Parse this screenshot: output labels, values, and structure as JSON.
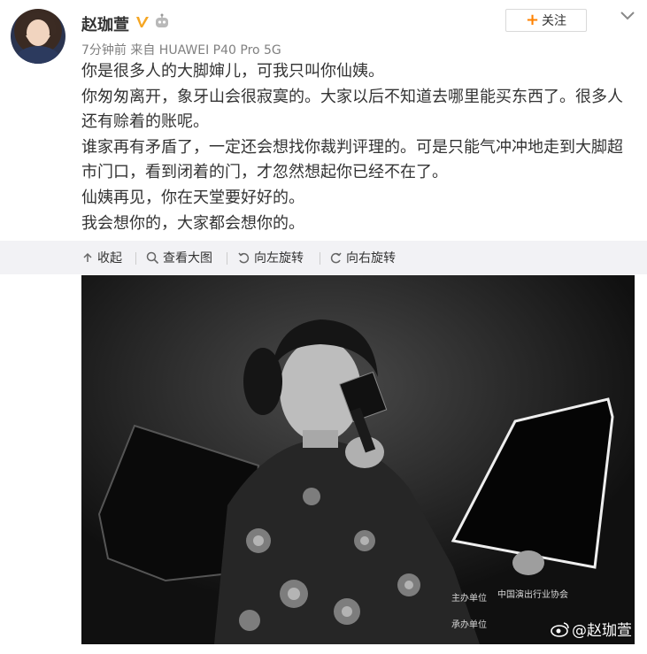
{
  "user": {
    "name": "赵珈萱",
    "verified_icon": "verified-v-icon",
    "robot_icon": "robot-icon",
    "meta": "7分钟前 来自 HUAWEI P40 Pro 5G"
  },
  "follow_button": {
    "label": "关注",
    "icon": "plus-icon"
  },
  "post": {
    "paragraphs": [
      "你是很多人的大脚婶儿，可我只叫你仙姨。",
      "你匆匆离开，象牙山会很寂寞的。大家以后不知道去哪里能买东西了。很多人还有赊着的账呢。",
      "谁家再有矛盾了，一定还会想找你裁判评理的。可是只能气冲冲地走到大脚超市门口，看到闭着的门，才忽然想起你已经不在了。",
      "仙姨再见，你在天堂要好好的。",
      "我会想你的，大家都会想你的。"
    ]
  },
  "toolbar": {
    "collapse": "收起",
    "view_large": "查看大图",
    "rotate_left": "向左旋转",
    "rotate_right": "向右旋转"
  },
  "photo": {
    "caption_host": "主办单位",
    "caption_org": "中国演出行业协会",
    "caption_co": "承办单位",
    "watermark": "@赵珈萱"
  }
}
